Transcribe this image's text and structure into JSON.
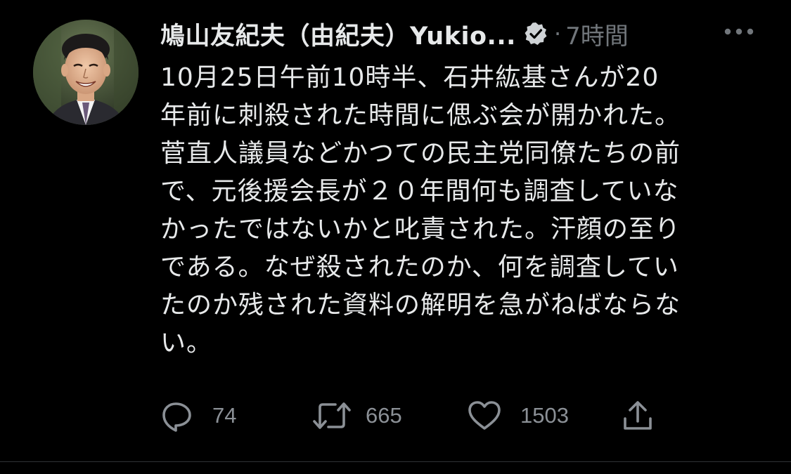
{
  "tweet": {
    "display_name": "鳩山友紀夫（由紀夫）Yukio...",
    "separator": "·",
    "time": "7時間",
    "text_lines": [
      "10月25日午前10時半、石井紘基さんが20",
      "年前に刺殺された時間に偲ぶ会が開かれた。",
      "菅直人議員などかつての民主党同僚たちの前",
      "で、元後援会長が２０年間何も調査していな",
      "かったではないかと叱責された。汗顔の至り",
      "である。なぜ殺されたのか、何を調査してい",
      "たのか残された資料の解明を急がねばならな",
      "い。"
    ],
    "actions": {
      "reply_count": "74",
      "retweet_count": "665",
      "like_count": "1503"
    },
    "icons": {
      "verified": "verified-badge-icon",
      "more": "more-options-icon",
      "reply": "reply-icon",
      "retweet": "retweet-icon",
      "like": "heart-icon",
      "share": "share-icon"
    },
    "colors": {
      "background": "#000000",
      "text": "#e7e9ea",
      "muted": "#71767b"
    }
  }
}
